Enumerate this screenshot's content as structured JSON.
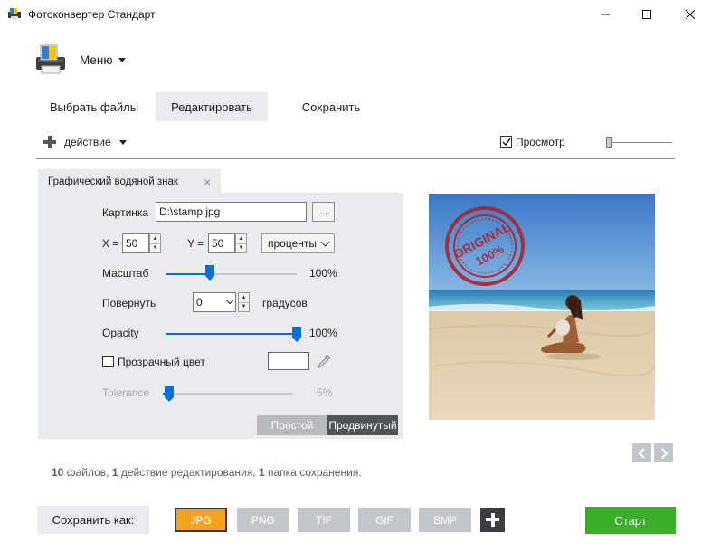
{
  "window": {
    "title": "Фотоконвертер Стандарт"
  },
  "menu": {
    "label": "Меню"
  },
  "tabs": [
    {
      "label": "Выбрать файлы",
      "active": false
    },
    {
      "label": "Редактировать",
      "active": true
    },
    {
      "label": "Сохранить",
      "active": false
    }
  ],
  "toolbar": {
    "action_label": "действие",
    "preview_label": "Просмотр",
    "preview_checked": true
  },
  "panel": {
    "tab_title": "Графический водяной знак",
    "image_label": "Картинка",
    "image_path": "D:\\stamp.jpg",
    "browse_label": "...",
    "x_label": "X =",
    "x_value": "50",
    "y_label": "Y =",
    "y_value": "50",
    "units": "проценты",
    "scale_label": "Масштаб",
    "scale_value": "100%",
    "scale_fraction": 0.33,
    "rotate_label": "Повернуть",
    "rotate_value": "0",
    "rotate_units": "градусов",
    "opacity_label": "Opacity",
    "opacity_value": "100%",
    "opacity_fraction": 1.0,
    "transparent_label": "Прозрачный цвет",
    "transparent_checked": false,
    "tolerance_label": "Tolerance",
    "tolerance_value": "5%",
    "tolerance_fraction": 0.05,
    "mode_simple": "Простой",
    "mode_advanced": "Продвинутый"
  },
  "preview_image": {
    "stamp_text_1": "ORIGINAL",
    "stamp_text_2": "100%"
  },
  "summary": {
    "files_count": "10",
    "files_text": "файлов,",
    "actions_count": "1",
    "actions_text": "действие редактирования,",
    "folders_count": "1",
    "folders_text": "папка сохранения."
  },
  "bottom": {
    "save_as_label": "Сохранить как:",
    "formats": [
      "JPG",
      "PNG",
      "TIF",
      "GIF",
      "BMP"
    ],
    "active_format": "JPG",
    "start_label": "Старт"
  },
  "colors": {
    "accent_orange": "#f7a21b",
    "start_green": "#3cae2b",
    "slider_blue": "#0a6fd0",
    "panel_bg": "#e9ebee",
    "stamp_red": "#a8262e"
  }
}
